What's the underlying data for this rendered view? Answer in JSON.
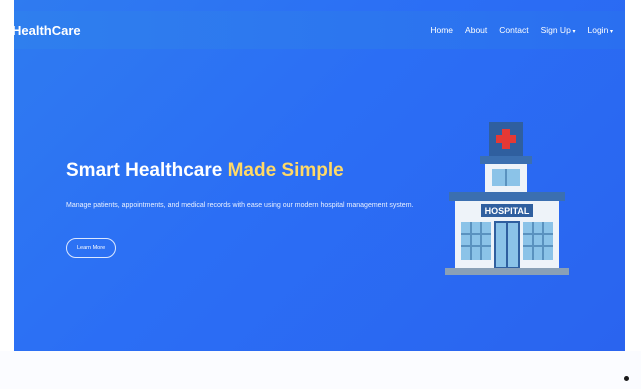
{
  "nav": {
    "brand": "HealthCare",
    "links": [
      "Home",
      "About",
      "Contact"
    ],
    "signup": "Sign Up",
    "login": "Login"
  },
  "hero": {
    "title_main": "Smart Healthcare",
    "title_accent": "Made Simple",
    "description": "Manage patients, appointments, and medical records with ease using our modern hospital management system.",
    "cta": "Learn More"
  },
  "illustration": {
    "sign": "HOSPITAL",
    "icons": [
      "hospital-building-icon",
      "medical-cross-icon"
    ]
  },
  "colors": {
    "primary": "#2b6ef5",
    "accent": "#ffd966",
    "hospital_blue": "#2f5f9f",
    "hospital_wall": "#eef3f9"
  }
}
